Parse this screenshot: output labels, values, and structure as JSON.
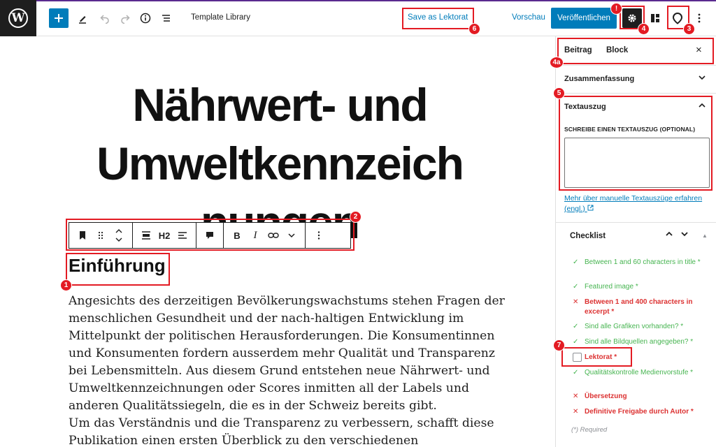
{
  "topbar": {
    "logo": "W",
    "title": "Template Library",
    "save_lektorat": "Save as Lektorat",
    "preview": "Vorschau",
    "publish": "Veröffentlichen",
    "icons": [
      "add-icon",
      "pen-icon",
      "undo-icon",
      "redo-icon",
      "info-icon",
      "list-view-icon",
      "settings-gear-icon",
      "blocks-icon",
      "yoast-pin-icon",
      "more-vertical-icon"
    ]
  },
  "editor": {
    "post_title_lines": [
      "Nährwert- und",
      "Umweltkennzeich",
      "nungen"
    ],
    "block_toolbar": {
      "heading_level": "H2",
      "bold": "B",
      "italic": "I"
    },
    "heading": "Einführung",
    "paragraph_lines": [
      "Angesichts des derzeitigen Bevölkerungswachstums stehen Fragen der",
      "menschlichen Gesundheit und der nach-haltigen Entwicklung im",
      "Mittelpunkt der politischen Herausforderungen. Die Konsumentinnen",
      "und Konsumenten fordern ausserdem mehr Qualität und Transparenz",
      "bei Lebensmitteln. Aus diesem Grund entstehen neue Nährwert- und",
      "Umweltkennzeichnungen oder Scores inmitten all der Labels und",
      "anderen Qualitätssiegeln, die es in der Schweiz bereits gibt.",
      "Um das Verständnis und die Transparenz zu verbessern, schafft diese",
      "Publikation einen ersten Überblick zu den verschiedenen"
    ]
  },
  "sidebar": {
    "tab_post": "Beitrag",
    "tab_block": "Block",
    "close": "×",
    "panel_summary": "Zusammenfassung",
    "panel_excerpt": "Textauszug",
    "excerpt_label": "SCHREIBE EINEN TEXTAUSZUG (OPTIONAL)",
    "excerpt_value": "",
    "excerpt_link": "Mehr über manuelle Textauszüge erfahren (engl.)",
    "checklist_title": "Checklist",
    "checklist_items": [
      {
        "text": "Between 1 and 60 characters in title *",
        "status": "ok"
      },
      {
        "text": "Featured image *",
        "status": "ok"
      },
      {
        "text": "Between 1 and 400 characters in excerpt *",
        "status": "fail"
      },
      {
        "text": "Sind alle Grafiken vorhanden? *",
        "status": "ok"
      },
      {
        "text": "Sind alle Bildquellen angegeben? *",
        "status": "ok"
      },
      {
        "text": "Lektorat *",
        "status": "pending"
      },
      {
        "text": "Qualitätskontrolle Medienvorstufe *",
        "status": "ok"
      },
      {
        "text": "Übersetzung",
        "status": "fail"
      },
      {
        "text": "Definitive Freigabe durch Autor *",
        "status": "fail"
      }
    ],
    "required_note": "(*) Required"
  },
  "annotations": {
    "n1": "1",
    "n2": "2",
    "n3": "3",
    "n4": "4",
    "n4a": "4a",
    "n5": "5",
    "n6": "6",
    "n7": "7",
    "alert": "!"
  },
  "colors": {
    "accent": "#007cba",
    "annotation_red": "#e31b23",
    "check_green": "#46b450",
    "fail_red": "#dc3232",
    "dark": "#1e1e1e"
  }
}
